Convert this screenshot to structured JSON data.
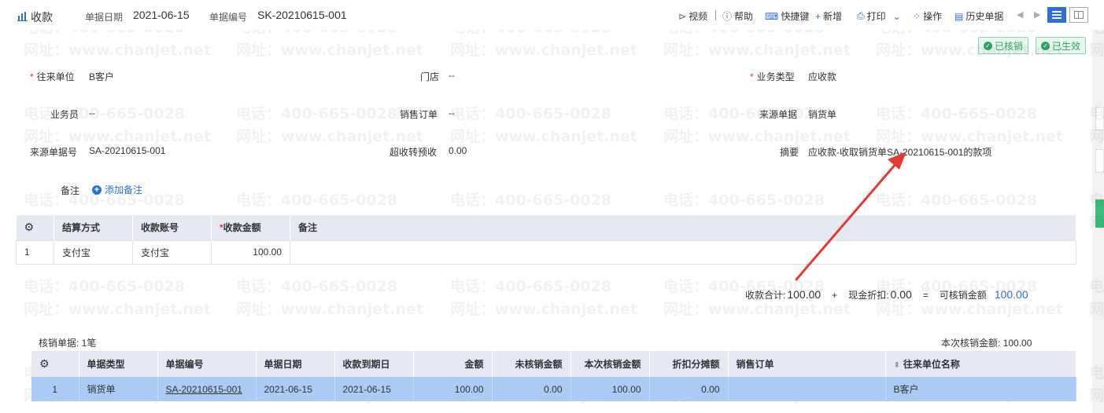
{
  "header": {
    "tab_title": "收款",
    "doc_date_label": "单据日期",
    "doc_date": "2021-06-15",
    "doc_no_label": "单据编号",
    "doc_no": "SK-20210615-001"
  },
  "toolbar": {
    "video": "视频",
    "help": "帮助",
    "shortcut": "快捷键",
    "add": "新增",
    "print": "打印",
    "operate": "操作",
    "history": "历史单据"
  },
  "status": {
    "verified": "已核销",
    "effective": "已生效"
  },
  "watermark": {
    "phone": "电话：400-665-0028",
    "site": "网址：www.chanjet.net"
  },
  "form": {
    "partner_label": "往来单位",
    "partner_value": "B客户",
    "store_label": "门店",
    "store_value": "--",
    "biz_type_label": "业务类型",
    "biz_type_value": "应收款",
    "salesman_label": "业务员",
    "salesman_value": "--",
    "sales_order_label": "销售订单",
    "sales_order_value": "--",
    "source_doc_label": "来源单据",
    "source_doc_value": "销货单",
    "source_no_label": "来源单据号",
    "source_no_value": "SA-20210615-001",
    "overpay_label": "超收转预收",
    "overpay_value": "0.00",
    "summary_label": "摘要",
    "summary_value": "应收款-收取销货单SA-20210615-001的款项",
    "remark_label": "备注",
    "add_remark": "添加备注"
  },
  "payment_table": {
    "headers": [
      "结算方式",
      "收款账号",
      "收款金额",
      "备注"
    ],
    "rows": [
      {
        "index": "1",
        "method": "支付宝",
        "account": "支付宝",
        "amount": "100.00",
        "note": ""
      }
    ]
  },
  "totals": {
    "received_label": "收款合计:",
    "received_value": "100.00",
    "plus": "+",
    "discount_label": "现金折扣:",
    "discount_value": "0.00",
    "equals": "=",
    "verifiable_label": "可核销金额",
    "verifiable_value": "100.00"
  },
  "verify_section": {
    "count_caption": "核销单据: 1笔",
    "amount_caption": "本次核销金额: 100.00",
    "headers": [
      "单据类型",
      "单据编号",
      "单据日期",
      "收款到期日",
      "金额",
      "未核销金额",
      "本次核销金额",
      "折扣分摊额",
      "销售订单",
      "往来单位名称"
    ],
    "rows": [
      {
        "index": "1",
        "type": "销货单",
        "no": "SA-20210615-001",
        "date": "2021-06-15",
        "due": "2021-06-15",
        "amount": "100.00",
        "unverified": "0.00",
        "this_verify": "100.00",
        "discount": "0.00",
        "order": "",
        "partner": "B客户"
      }
    ]
  },
  "colors": {
    "accent": "#2d6fd9",
    "arrow": "#e53935",
    "selected_row": "#aacbf4",
    "header_bg": "#e6e9f2",
    "success": "#2ea464"
  }
}
